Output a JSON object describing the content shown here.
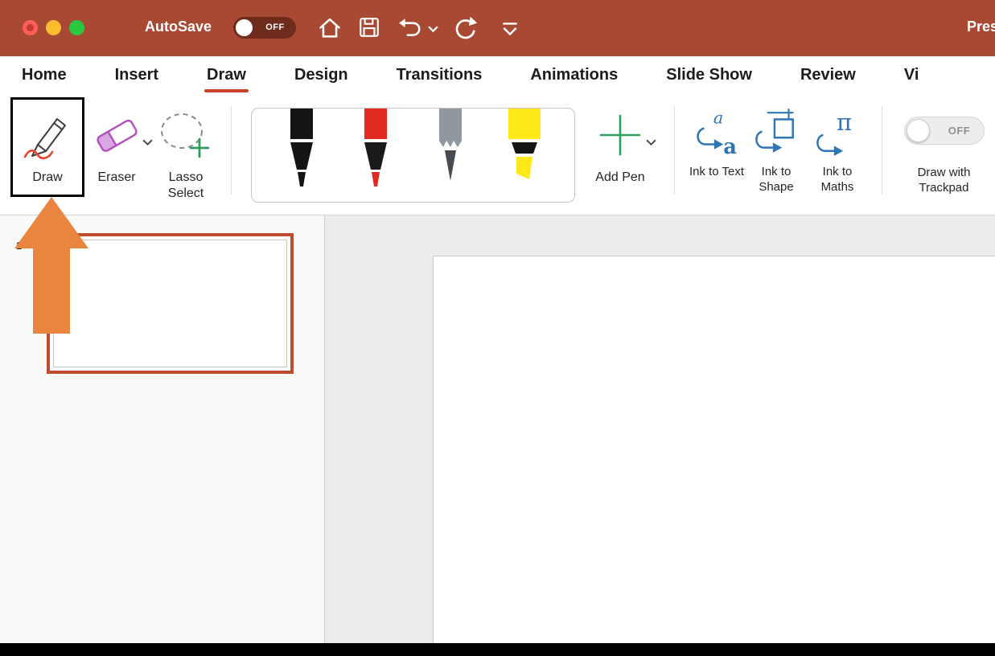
{
  "titlebar": {
    "autosave_label": "AutoSave",
    "autosave_state": "OFF",
    "document_title": "Pres",
    "bg_color": "#A84A33"
  },
  "tabs": {
    "items": [
      {
        "label": "Home",
        "active": false
      },
      {
        "label": "Insert",
        "active": false
      },
      {
        "label": "Draw",
        "active": true
      },
      {
        "label": "Design",
        "active": false
      },
      {
        "label": "Transitions",
        "active": false
      },
      {
        "label": "Animations",
        "active": false
      },
      {
        "label": "Slide Show",
        "active": false
      },
      {
        "label": "Review",
        "active": false
      },
      {
        "label": "Vi",
        "active": false
      }
    ],
    "active_underline_color": "#C7402B"
  },
  "ribbon": {
    "draw": {
      "label": "Draw",
      "ink_color": "#E8432C"
    },
    "eraser": {
      "label": "Eraser",
      "color": "#B44FBE"
    },
    "lasso": {
      "label": "Lasso Select",
      "plus_color": "#2E9C5B"
    },
    "pens": [
      {
        "name": "black-pen",
        "body": "#141414",
        "mid": "#141414",
        "tip": "#141414"
      },
      {
        "name": "red-pen",
        "body": "#E12B20",
        "mid": "#1A1A1A",
        "tip": "#E12B20"
      },
      {
        "name": "gray-pencil",
        "body": "#8E989E",
        "mid": "#454B50"
      },
      {
        "name": "yellow-highlighter",
        "body": "#FFE81A",
        "mid": "#141414",
        "tip": "#FFE81A"
      }
    ],
    "add_pen": {
      "label": "Add Pen",
      "plus_color": "#2E9C5B"
    },
    "ink_to_text": {
      "label": "Ink to Text",
      "glyph": "a"
    },
    "ink_to_shape": {
      "label": "Ink to Shape"
    },
    "ink_to_maths": {
      "label": "Ink to Maths",
      "glyph": "π"
    },
    "ink_icon_color": "#2E75B5",
    "trackpad": {
      "label": "Draw with Trackpad",
      "state": "OFF"
    }
  },
  "slides_panel": {
    "slide_number": "1",
    "selected_border_color": "#BE4B2F"
  },
  "annotations": {
    "arrow_color": "#E9853E",
    "highlight_border_color": "#000000"
  }
}
